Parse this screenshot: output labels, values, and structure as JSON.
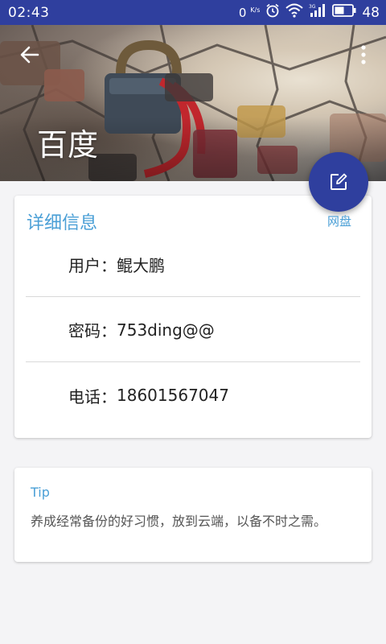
{
  "status_bar": {
    "time": "02:43",
    "network_speed": "0",
    "network_unit": "K/s",
    "battery_level": "48"
  },
  "toolbar": {
    "title": "百度",
    "back_icon": "arrow-left-icon",
    "more_icon": "more-vertical-icon"
  },
  "fab": {
    "icon": "edit-icon",
    "label": "网盘",
    "color": "#2f3f9e"
  },
  "details": {
    "title": "详细信息",
    "rows": [
      {
        "label": "用户：",
        "value": "鲲大鹏"
      },
      {
        "label": "密码：",
        "value": "753ding@@"
      },
      {
        "label": "电话：",
        "value": "18601567047"
      }
    ]
  },
  "tip": {
    "title": "Tip",
    "text": "养成经常备份的好习惯，放到云端，以备不时之需。"
  },
  "colors": {
    "primary": "#2f3f9e",
    "accent_text": "#4a9fd6"
  }
}
